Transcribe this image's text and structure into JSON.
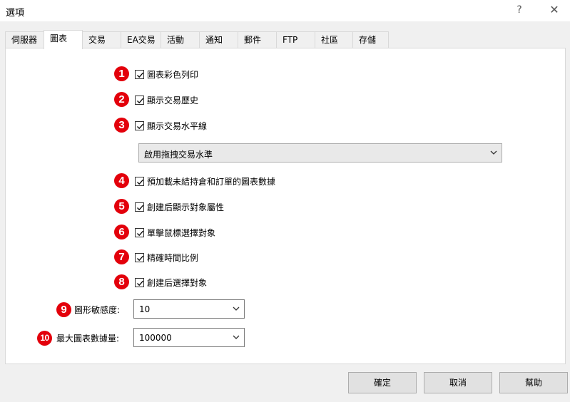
{
  "window": {
    "title": "選項",
    "help": "?",
    "close": "✕"
  },
  "tabs": [
    {
      "label": "伺服器"
    },
    {
      "label": "圖表"
    },
    {
      "label": "交易"
    },
    {
      "label": "EA交易"
    },
    {
      "label": "活動"
    },
    {
      "label": "通知"
    },
    {
      "label": "郵件"
    },
    {
      "label": "FTP"
    },
    {
      "label": "社區"
    },
    {
      "label": "存儲"
    }
  ],
  "active_tab": "圖表",
  "options": [
    {
      "num": "1",
      "label": "圖表彩色列印",
      "checked": true
    },
    {
      "num": "2",
      "label": "顯示交易歷史",
      "checked": true
    },
    {
      "num": "3",
      "label": "顯示交易水平線",
      "checked": true
    },
    {
      "num": "4",
      "label": "預加載未結持倉和訂單的圖表數據",
      "checked": true
    },
    {
      "num": "5",
      "label": "創建后顯示對象屬性",
      "checked": true
    },
    {
      "num": "6",
      "label": "單擊鼠標選擇對象",
      "checked": true
    },
    {
      "num": "7",
      "label": "精確時間比例",
      "checked": true
    },
    {
      "num": "8",
      "label": "創建后選擇對象",
      "checked": true
    }
  ],
  "drag_trade_select": {
    "value": "啟用拖拽交易水準"
  },
  "sensitivity": {
    "num": "9",
    "label": "圖形敏感度:",
    "value": "10"
  },
  "max_bars": {
    "num": "10",
    "label": "最大圖表數據量:",
    "value": "100000"
  },
  "buttons": {
    "ok": "確定",
    "cancel": "取消",
    "help": "幫助"
  },
  "colors": {
    "badge": "#e3000b",
    "panel": "#ffffff",
    "background": "#f0f0f0"
  }
}
